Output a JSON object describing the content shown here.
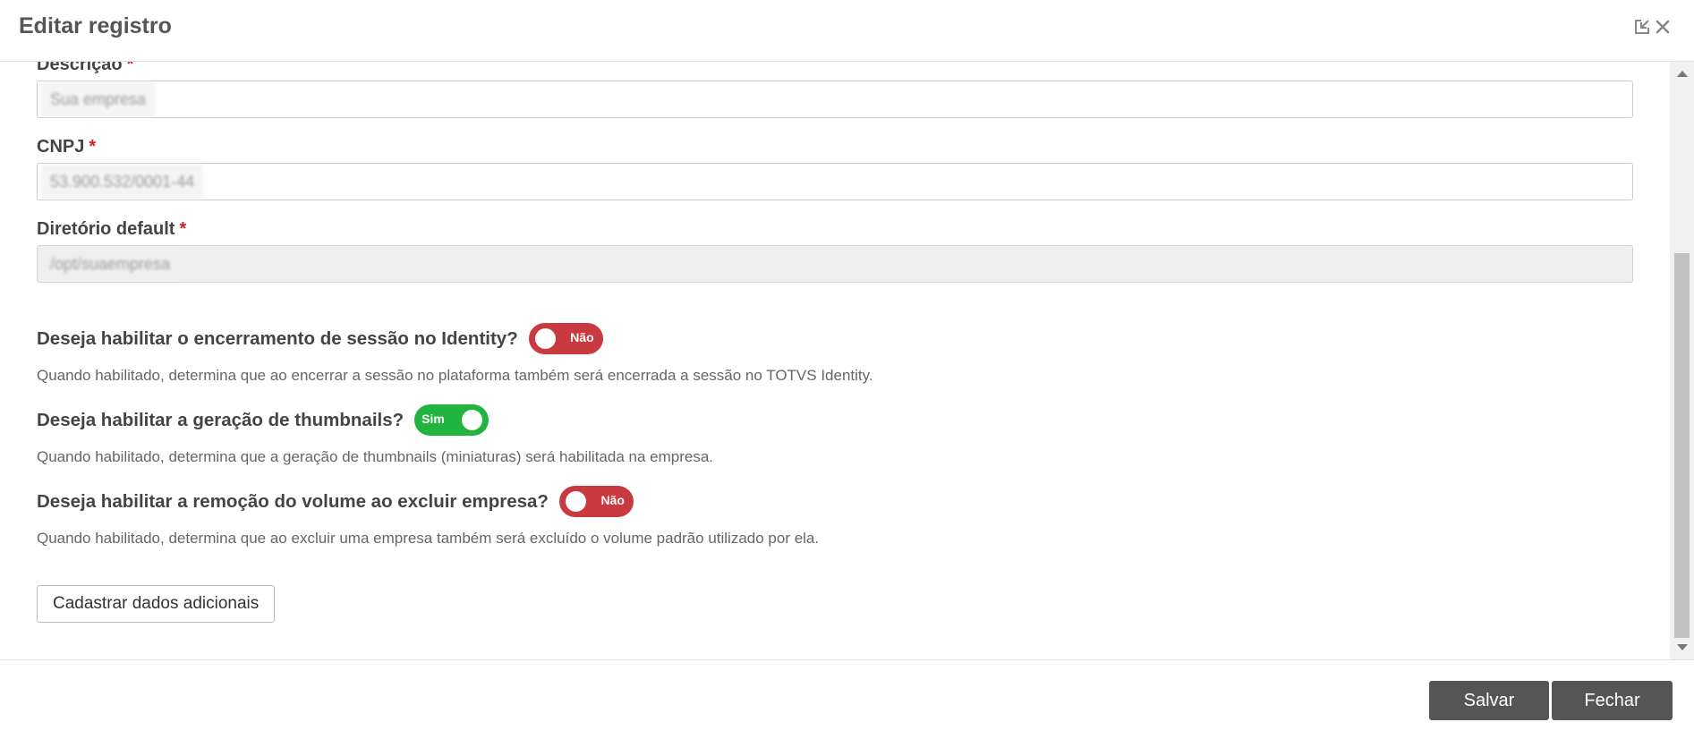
{
  "modal": {
    "title": "Editar registro"
  },
  "fields": {
    "descricao": {
      "label": "Descrição",
      "required_mark": "*",
      "value": "Sua empresa"
    },
    "cnpj": {
      "label": "CNPJ",
      "required_mark": "*",
      "value": "53.900.532/0001-44"
    },
    "diretorio": {
      "label": "Diretório default",
      "required_mark": "*",
      "value": "/opt/suaempresa"
    }
  },
  "options": [
    {
      "question": "Deseja habilitar o encerramento de sessão no Identity?",
      "toggle_label": "Não",
      "enabled": false,
      "help": "Quando habilitado, determina que ao encerrar a sessão no plataforma também será encerrada a sessão no TOTVS Identity."
    },
    {
      "question": "Deseja habilitar a geração de thumbnails?",
      "toggle_label": "Sim",
      "enabled": true,
      "help": "Quando habilitado, determina que a geração de thumbnails (miniaturas) será habilitada na empresa."
    },
    {
      "question": "Deseja habilitar a remoção do volume ao excluir empresa?",
      "toggle_label": "Não",
      "enabled": false,
      "help": "Quando habilitado, determina que ao excluir uma empresa também será excluído o volume padrão utilizado por ela."
    }
  ],
  "buttons": {
    "extra": "Cadastrar dados adicionais",
    "save": "Salvar",
    "close": "Fechar"
  },
  "colors": {
    "toggle_off": "#c83a3f",
    "toggle_on": "#21b43f",
    "button_dark": "#555555",
    "required": "#d02020"
  },
  "icons": {
    "minimize": "minimize-icon",
    "close": "close-icon"
  }
}
